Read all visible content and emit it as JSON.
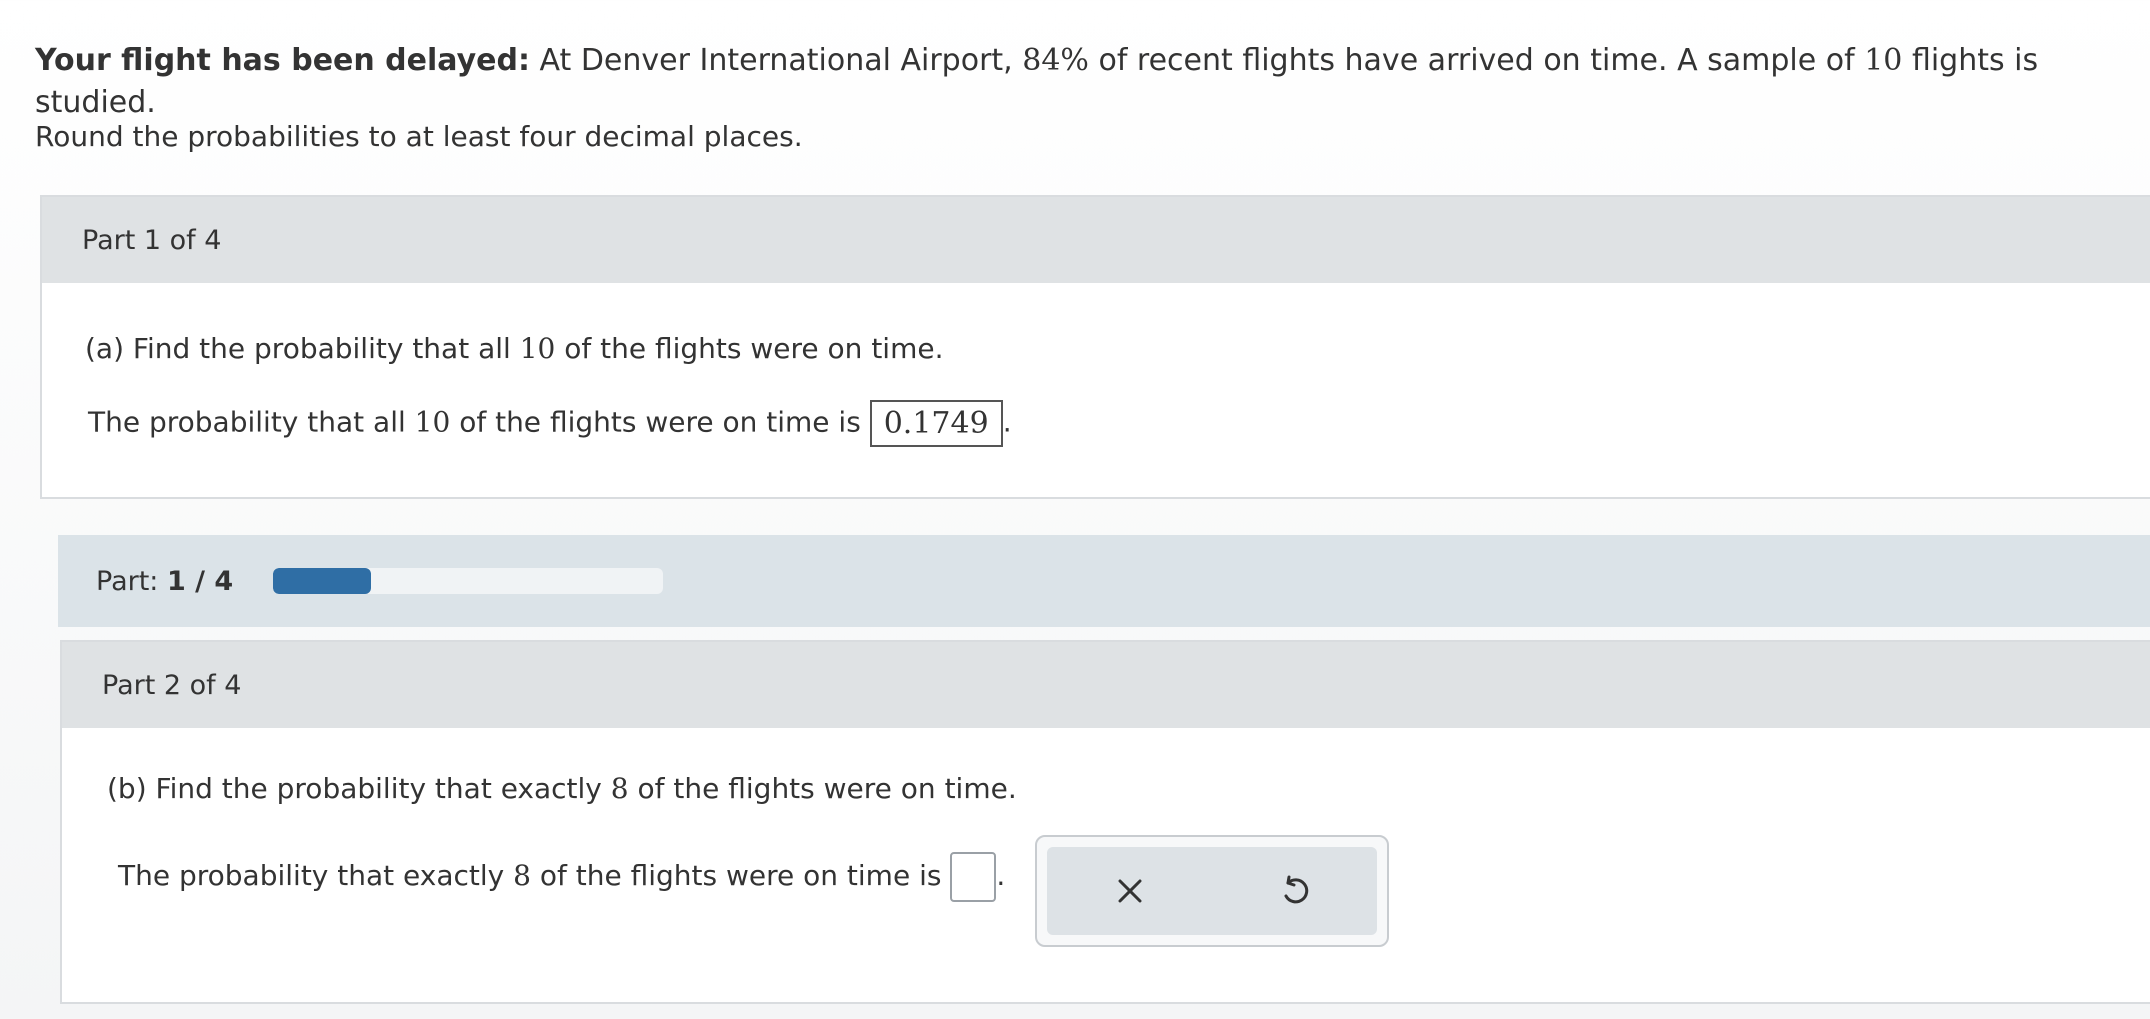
{
  "problem": {
    "title": "Your flight has been delayed:",
    "text_1": " At Denver International Airport, ",
    "percent": "84%",
    "text_2": " of recent flights have arrived on time. A sample of ",
    "sample_size": "10",
    "text_3": " flights is studied."
  },
  "instruction": "Round the probabilities to at least four decimal places.",
  "part1": {
    "header": "Part 1 of 4",
    "question_prefix": "(a) Find the probability that all ",
    "question_num": "10",
    "question_suffix": " of the flights were on time.",
    "answer_prefix": "The probability that all ",
    "answer_num": "10",
    "answer_suffix": " of the flights were on time is ",
    "answer_value": "0.1749",
    "period": "."
  },
  "progress": {
    "label": "Part: ",
    "current": "1 / 4",
    "fraction": 0.25,
    "fill_color": "#2f6ea5"
  },
  "part2": {
    "header": "Part 2 of 4",
    "question_prefix": "(b) Find the probability that exactly ",
    "question_num": "8",
    "question_suffix": " of the flights were on time.",
    "answer_prefix": "The probability that exactly ",
    "answer_num": "8",
    "answer_suffix": " of the flights were on time is ",
    "answer_value": "",
    "period": "."
  },
  "tools": {
    "clear_icon": "x-icon",
    "undo_icon": "undo-icon"
  }
}
